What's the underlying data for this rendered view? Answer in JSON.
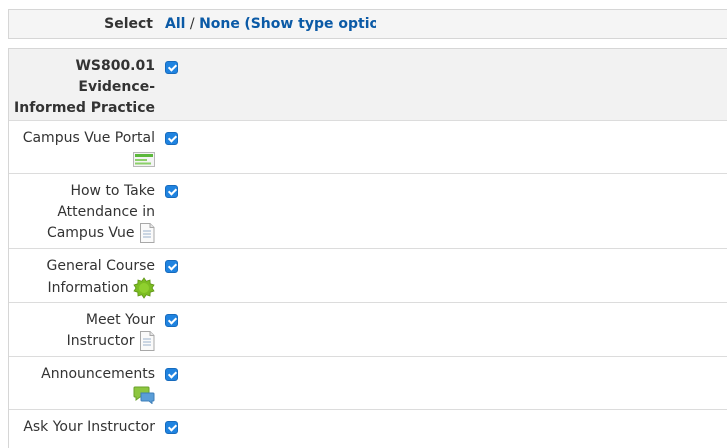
{
  "select_bar": {
    "label": "Select",
    "all": "All",
    "separator": "/",
    "none": "None",
    "show_type_options": "(Show type optio"
  },
  "items": [
    {
      "lines": [
        "WS800.01",
        "Evidence-",
        "Informed Practice"
      ],
      "type": "section",
      "icon": "",
      "checked": true
    },
    {
      "lines": [
        "Campus Vue Portal"
      ],
      "type": "url",
      "icon": "web-page-icon",
      "checked": true
    },
    {
      "lines": [
        "How to Take",
        "Attendance in",
        "Campus Vue"
      ],
      "type": "page",
      "icon": "page-icon",
      "checked": true
    },
    {
      "lines": [
        "General Course",
        "Information"
      ],
      "type": "label",
      "icon": "label-badge-icon",
      "checked": true
    },
    {
      "lines": [
        "Meet Your",
        "Instructor"
      ],
      "type": "page",
      "icon": "page-icon",
      "checked": true
    },
    {
      "lines": [
        "Announcements"
      ],
      "type": "forum",
      "icon": "forum-icon",
      "checked": true
    },
    {
      "lines": [
        "Ask Your Instructor"
      ],
      "type": "forum",
      "icon": "",
      "checked": true
    }
  ],
  "colors": {
    "link": "#0b5aa6",
    "checkbox": "#1f83e0",
    "section_bg": "#f2f2f2"
  }
}
